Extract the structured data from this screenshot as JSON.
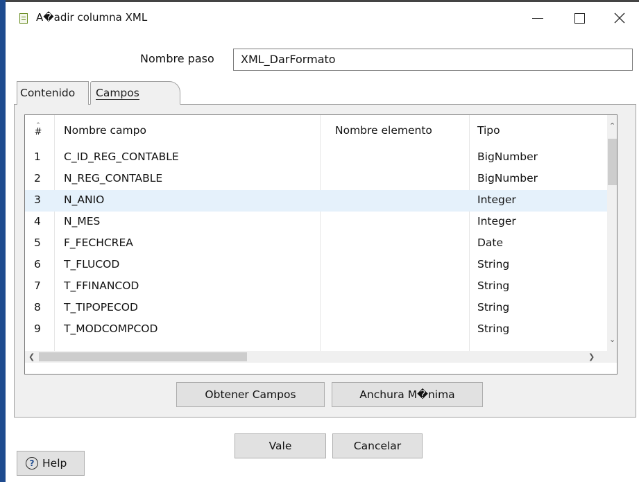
{
  "window": {
    "title": "A�adir columna XML",
    "minimize_icon": "minimize-icon",
    "maximize_icon": "maximize-icon",
    "close_icon": "close-icon"
  },
  "step": {
    "label": "Nombre paso",
    "value": "XML_DarFormato"
  },
  "tabs": [
    {
      "label": "Contenido",
      "active": false
    },
    {
      "label": "Campos",
      "active": true
    }
  ],
  "table": {
    "headers": {
      "num": "#",
      "name": "Nombre campo",
      "element": "Nombre elemento",
      "type": "Tipo"
    },
    "selected_row": 3,
    "rows": [
      {
        "n": "1",
        "name": "C_ID_REG_CONTABLE",
        "element": "",
        "type": "BigNumber"
      },
      {
        "n": "2",
        "name": "N_REG_CONTABLE",
        "element": "",
        "type": "BigNumber"
      },
      {
        "n": "3",
        "name": "N_ANIO",
        "element": "",
        "type": "Integer"
      },
      {
        "n": "4",
        "name": "N_MES",
        "element": "",
        "type": "Integer"
      },
      {
        "n": "5",
        "name": "F_FECHCREA",
        "element": "",
        "type": "Date"
      },
      {
        "n": "6",
        "name": "T_FLUCOD",
        "element": "",
        "type": "String"
      },
      {
        "n": "7",
        "name": "T_FFINANCOD",
        "element": "",
        "type": "String"
      },
      {
        "n": "8",
        "name": "T_TIPOPECOD",
        "element": "",
        "type": "String"
      },
      {
        "n": "9",
        "name": "T_MODCOMPCOD",
        "element": "",
        "type": "String"
      }
    ]
  },
  "buttons": {
    "get_fields": "Obtener Campos",
    "min_width": "Anchura M�nima",
    "ok": "Vale",
    "cancel": "Cancelar",
    "help": "Help"
  },
  "colors": {
    "selected_row": "#e5f1fb",
    "button_bg": "#e1e1e1",
    "panel_bg": "#f0f0f0"
  }
}
